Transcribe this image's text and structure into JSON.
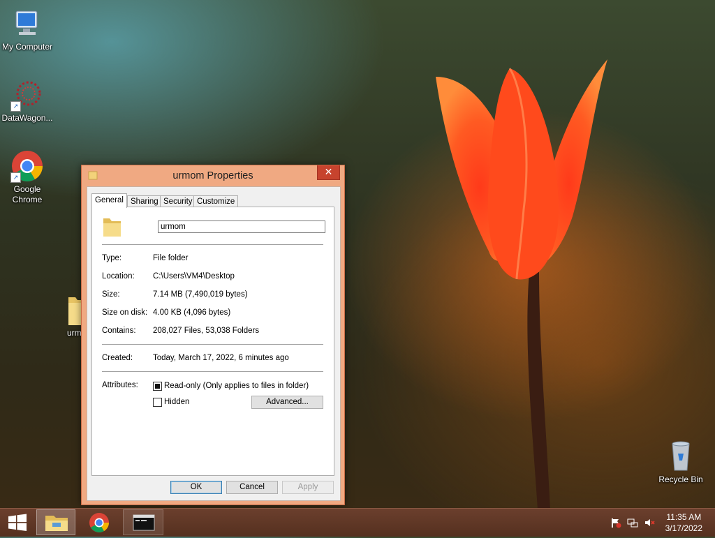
{
  "desktop": {
    "icons": [
      {
        "label": "My Computer"
      },
      {
        "label": "DataWagon..."
      },
      {
        "label": "Google Chrome"
      },
      {
        "label": "urm"
      },
      {
        "label": "Recycle Bin"
      }
    ]
  },
  "window": {
    "title": "urmom Properties",
    "close_label": "✕",
    "tabs": [
      {
        "label": "General"
      },
      {
        "label": "Sharing"
      },
      {
        "label": "Security"
      },
      {
        "label": "Customize"
      }
    ],
    "name_value": "urmom",
    "properties": [
      {
        "label": "Type:",
        "value": "File folder"
      },
      {
        "label": "Location:",
        "value": "C:\\Users\\VM4\\Desktop"
      },
      {
        "label": "Size:",
        "value": "7.14 MB (7,490,019 bytes)"
      },
      {
        "label": "Size on disk:",
        "value": "4.00 KB (4,096 bytes)"
      },
      {
        "label": "Contains:",
        "value": "208,027 Files, 53,038 Folders"
      }
    ],
    "created": {
      "label": "Created:",
      "value": "Today, March 17, 2022, 6 minutes ago"
    },
    "attributes": {
      "label": "Attributes:",
      "readonly": "Read-only (Only applies to files in folder)",
      "hidden": "Hidden",
      "advanced_button": "Advanced..."
    },
    "buttons": {
      "ok": "OK",
      "cancel": "Cancel",
      "apply": "Apply"
    }
  },
  "taskbar": {
    "clock_time": "11:35 AM",
    "clock_date": "3/17/2022"
  },
  "colors": {
    "window_frame": "#f0a982",
    "close_button": "#c7432e",
    "taskbar": "#5e3625"
  }
}
